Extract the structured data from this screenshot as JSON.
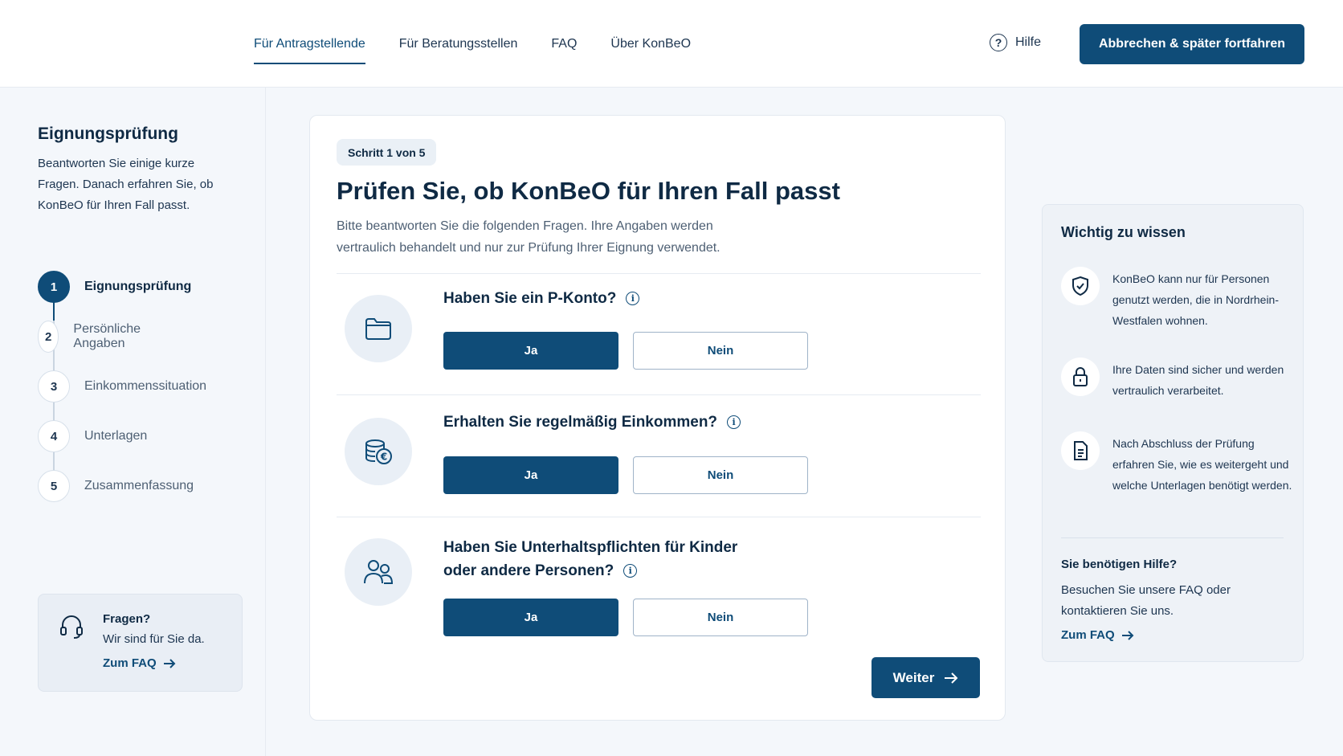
{
  "header": {
    "nav": [
      "Für Antragstellende",
      "Für Beratungsstellen",
      "FAQ",
      "Über KonBeO"
    ],
    "active_nav": "Für Antragstellende",
    "help_label": "Hilfe",
    "cancel_label": "Abbrechen & später fortfahren"
  },
  "sidebar": {
    "title": "Eignungsprüfung",
    "description": "Beantworten Sie einige kurze Fragen. Danach erfahren Sie, ob KonBeO für Ihren Fall passt.",
    "steps": [
      {
        "num": "1",
        "label": "Eignungsprüfung"
      },
      {
        "num": "2",
        "label": "Persönliche Angaben"
      },
      {
        "num": "3",
        "label": "Einkommenssituation"
      },
      {
        "num": "4",
        "label": "Unterlagen"
      },
      {
        "num": "5",
        "label": "Zusammenfassung"
      }
    ],
    "help": {
      "title": "Fragen?",
      "text": "Wir sind für Sie da.",
      "link": "Zum FAQ"
    }
  },
  "main": {
    "step_badge": "Schritt 1 von 5",
    "title": "Prüfen Sie, ob KonBeO für Ihren Fall passt",
    "description": "Bitte beantworten Sie die folgenden Fragen. Ihre Angaben werden vertraulich behandelt und nur zur Prüfung Ihrer Eignung verwendet.",
    "questions": [
      {
        "text": "Haben Sie ein P-Konto?",
        "icon": "folder-icon",
        "yes": "Ja",
        "no": "Nein",
        "selected": "Ja"
      },
      {
        "text": "Erhalten Sie regelmäßig Einkommen?",
        "icon": "coins-euro-icon",
        "yes": "Ja",
        "no": "Nein",
        "selected": "Ja"
      },
      {
        "text_line1": "Haben Sie Unterhaltspflichten für Kinder",
        "text_line2": "oder andere Personen?",
        "icon": "people-icon",
        "yes": "Ja",
        "no": "Nein",
        "selected": "Ja"
      }
    ],
    "next_label": "Weiter"
  },
  "info_panel": {
    "title": "Wichtig zu wissen",
    "items": [
      {
        "icon": "shield-icon",
        "text": "KonBeO kann nur für Personen genutzt werden, die in Nordrhein-Westfalen wohnen."
      },
      {
        "icon": "lock-icon",
        "text": "Ihre Daten sind sicher und werden vertraulich verarbeitet."
      },
      {
        "icon": "document-icon",
        "text": "Nach Abschluss der Prüfung erfahren Sie, wie es weitergeht und welche Unterlagen benötigt werden."
      }
    ],
    "help_title": "Sie benötigen Hilfe?",
    "help_text": "Besuchen Sie unsere FAQ oder kontaktieren Sie uns.",
    "help_link": "Zum FAQ"
  },
  "colors": {
    "primary": "#0f4c78",
    "text": "#0f2a44",
    "background": "#f4f7fb"
  }
}
